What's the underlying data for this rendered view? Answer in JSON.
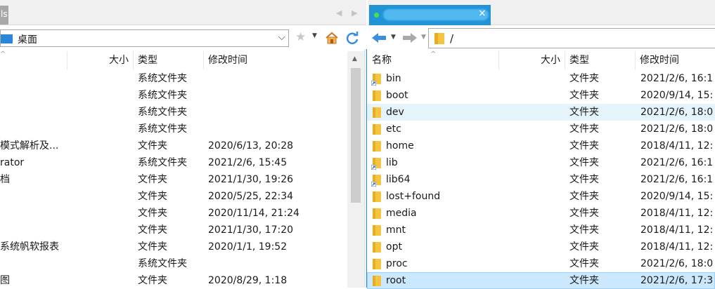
{
  "left_pane": {
    "tab_label": "ls",
    "address": "桌面",
    "columns": {
      "size": "大小",
      "type": "类型",
      "modified": "修改时间"
    },
    "rows": [
      {
        "name": "",
        "type": "系统文件夹",
        "modified": ""
      },
      {
        "name": "",
        "type": "系统文件夹",
        "modified": ""
      },
      {
        "name": "",
        "type": "系统文件夹",
        "modified": ""
      },
      {
        "name": "",
        "type": "系统文件夹",
        "modified": ""
      },
      {
        "name": "模式解析及...",
        "type": "文件夹",
        "modified": "2020/6/13, 20:28"
      },
      {
        "name": "rator",
        "type": "系统文件夹",
        "modified": "2021/2/6, 15:45"
      },
      {
        "name": "档",
        "type": "文件夹",
        "modified": "2021/1/30, 19:26"
      },
      {
        "name": "",
        "type": "文件夹",
        "modified": "2020/5/25, 22:34"
      },
      {
        "name": "",
        "type": "文件夹",
        "modified": "2020/11/14, 21:24"
      },
      {
        "name": "",
        "type": "文件夹",
        "modified": "2021/1/30, 17:20"
      },
      {
        "name": "系统帆软报表",
        "type": "文件夹",
        "modified": "2020/1/1, 19:52"
      },
      {
        "name": "",
        "type": "系统文件夹",
        "modified": ""
      },
      {
        "name": "图",
        "type": "文件夹",
        "modified": "2020/8/29, 1:18"
      }
    ]
  },
  "right_pane": {
    "tab_close": "×",
    "address": "/",
    "columns": {
      "name": "名称",
      "size": "大小",
      "type": "类型",
      "modified": "修改时间"
    },
    "rows": [
      {
        "name": "bin",
        "type": "文件夹",
        "modified": "2021/2/6, 16:1",
        "link": true
      },
      {
        "name": "boot",
        "type": "文件夹",
        "modified": "2020/9/14, 15:",
        "link": false
      },
      {
        "name": "dev",
        "type": "文件夹",
        "modified": "2021/2/6, 18:0",
        "link": false,
        "highlight": "hover"
      },
      {
        "name": "etc",
        "type": "文件夹",
        "modified": "2021/2/6, 18:0",
        "link": false
      },
      {
        "name": "home",
        "type": "文件夹",
        "modified": "2018/4/11, 12:",
        "link": false
      },
      {
        "name": "lib",
        "type": "文件夹",
        "modified": "2021/2/6, 16:1",
        "link": true
      },
      {
        "name": "lib64",
        "type": "文件夹",
        "modified": "2021/2/6, 16:1",
        "link": true
      },
      {
        "name": "lost+found",
        "type": "文件夹",
        "modified": "2020/9/14, 15:",
        "link": false
      },
      {
        "name": "media",
        "type": "文件夹",
        "modified": "2018/4/11, 12:",
        "link": false
      },
      {
        "name": "mnt",
        "type": "文件夹",
        "modified": "2018/4/11, 12:",
        "link": false
      },
      {
        "name": "opt",
        "type": "文件夹",
        "modified": "2018/4/11, 12:",
        "link": false
      },
      {
        "name": "proc",
        "type": "文件夹",
        "modified": "2021/2/6, 18:0",
        "link": false
      },
      {
        "name": "root",
        "type": "文件夹",
        "modified": "2021/2/6, 17:3",
        "link": false,
        "highlight": "selected"
      }
    ]
  },
  "colors": {
    "accent_tab": "#2294d6",
    "hover_row": "#e5f3fb",
    "selected_row": "#cce8ff",
    "folder": "#f5c542"
  },
  "icons": [
    "folder-icon",
    "star-icon",
    "home-icon",
    "refresh-icon",
    "back-arrow-icon",
    "forward-arrow-icon",
    "close-icon",
    "chevron-down-icon"
  ]
}
